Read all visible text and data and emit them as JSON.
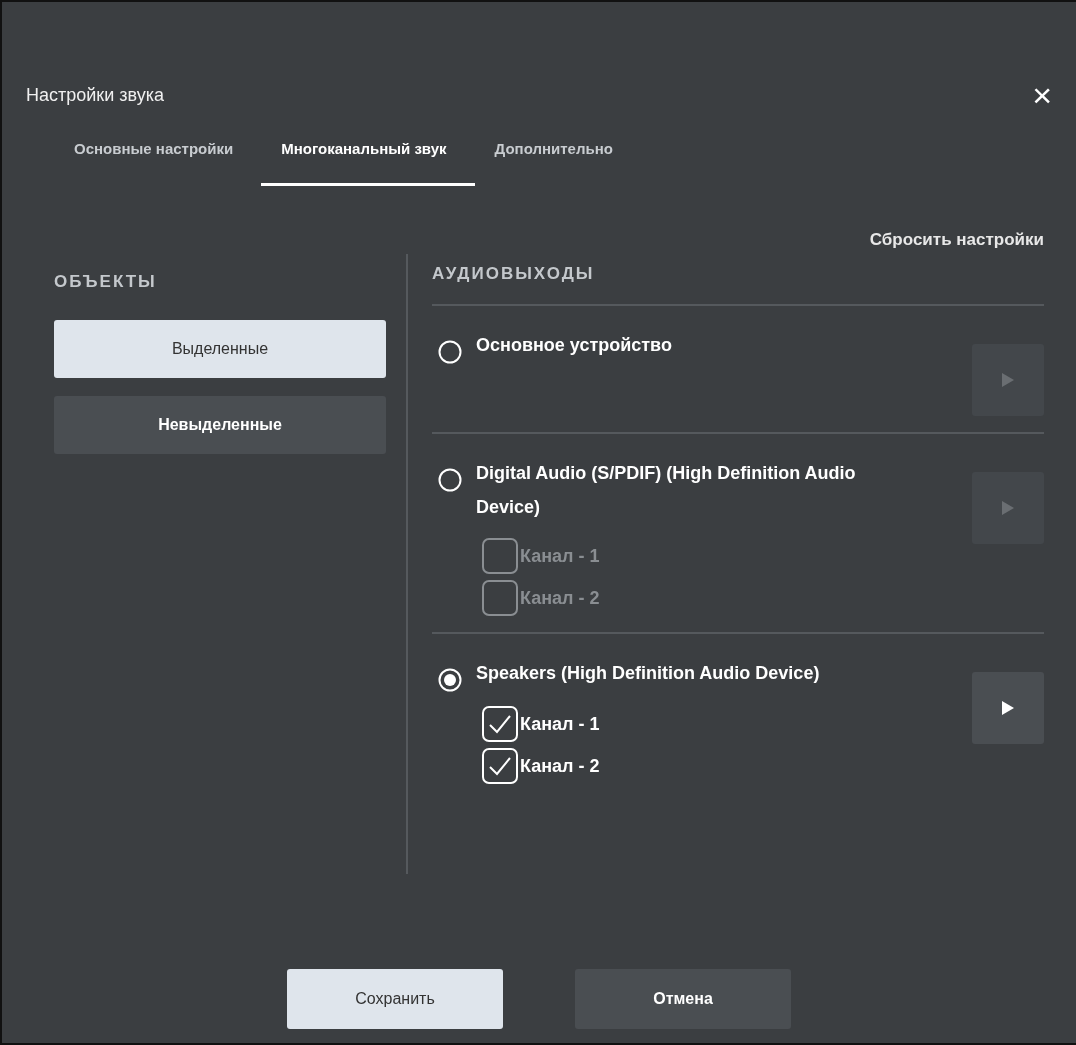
{
  "window": {
    "title": "Настройки звука",
    "close": "×"
  },
  "tabs": [
    {
      "label": "Основные настройки",
      "selected": false
    },
    {
      "label": "Многоканальный звук",
      "selected": true
    },
    {
      "label": "Дополнительно",
      "selected": false
    }
  ],
  "reset": "Сбросить настройки",
  "objects": {
    "heading": "ОБЪЕКТЫ",
    "options": [
      {
        "label": "Выделенные",
        "selected": true
      },
      {
        "label": "Невыделенные",
        "selected": false
      }
    ]
  },
  "outputs": {
    "heading": "АУДИОВЫХОДЫ",
    "devices": [
      {
        "name": "Основное устройство",
        "selected": false,
        "play_enabled": false
      },
      {
        "name": "Digital Audio (S/PDIF) (High Definition Audio Device)",
        "selected": false,
        "play_enabled": false,
        "channels": [
          {
            "label": "Канал - 1",
            "checked": false,
            "disabled": true
          },
          {
            "label": "Канал - 2",
            "checked": false,
            "disabled": true
          }
        ]
      },
      {
        "name": "Speakers (High Definition Audio Device)",
        "selected": true,
        "play_enabled": true,
        "channels": [
          {
            "label": "Канал - 1",
            "checked": true,
            "disabled": false
          },
          {
            "label": "Канал - 2",
            "checked": true,
            "disabled": false
          }
        ]
      }
    ]
  },
  "buttons": [
    {
      "label": "Сохранить",
      "kind": "primary"
    },
    {
      "label": "Отмена",
      "kind": "secondary"
    }
  ]
}
